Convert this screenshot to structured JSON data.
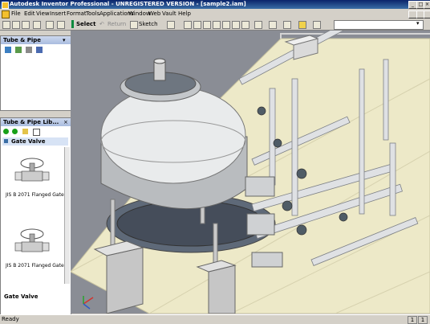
{
  "window": {
    "title": "Autodesk Inventor Professional - UNREGISTERED VERSION - [sample2.iam]",
    "controls": [
      "_",
      "□",
      "×"
    ]
  },
  "menu": {
    "items": [
      "File",
      "Edit",
      "View",
      "Insert",
      "Format",
      "Tools",
      "Applications",
      "Window",
      "Web",
      "Vault",
      "Help"
    ]
  },
  "toolbar": {
    "select_label": "Select",
    "return_label": "Return",
    "sketch_label": "Sketch"
  },
  "tube_panel": {
    "title": "Tube & Pipe"
  },
  "library_panel": {
    "title": "Tube & Pipe Lib...",
    "category": "Gate Valve",
    "items": [
      {
        "caption": "JIS B 2071 Flanged Gate"
      },
      {
        "caption": "JIS B 2071 Flanged Gate"
      }
    ],
    "footer_label": "Gate Valve"
  },
  "status": {
    "text": "Ready",
    "counters": [
      "1",
      "1"
    ]
  },
  "colors": {
    "title_start": "#0a246a",
    "title_end": "#3a6ea5",
    "viewport_bg": "#8a8d95",
    "floor": "#eeeacb"
  }
}
